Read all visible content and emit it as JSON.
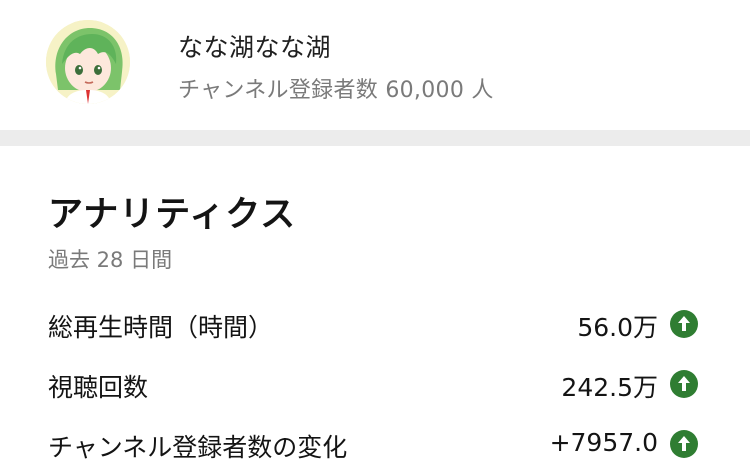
{
  "channel": {
    "name": "なな湖なな湖",
    "subscribers": "チャンネル登録者数 60,000 人"
  },
  "analytics": {
    "title": "アナリティクス",
    "period": "過去 28 日間",
    "metrics": [
      {
        "label": "総再生時間（時間）",
        "value": "56.0万",
        "trend": "up"
      },
      {
        "label": "視聴回数",
        "value": "242.5万",
        "trend": "up"
      },
      {
        "label": "チャンネル登録者数の変化",
        "value": "+7957.0",
        "trend": "up"
      }
    ]
  },
  "colors": {
    "trend_up": "#2f7d32",
    "separator": "#ececec",
    "secondary_text": "#7a7a7a"
  },
  "icons": {
    "avatar": "channel-avatar",
    "trend": "arrow-up-icon"
  }
}
